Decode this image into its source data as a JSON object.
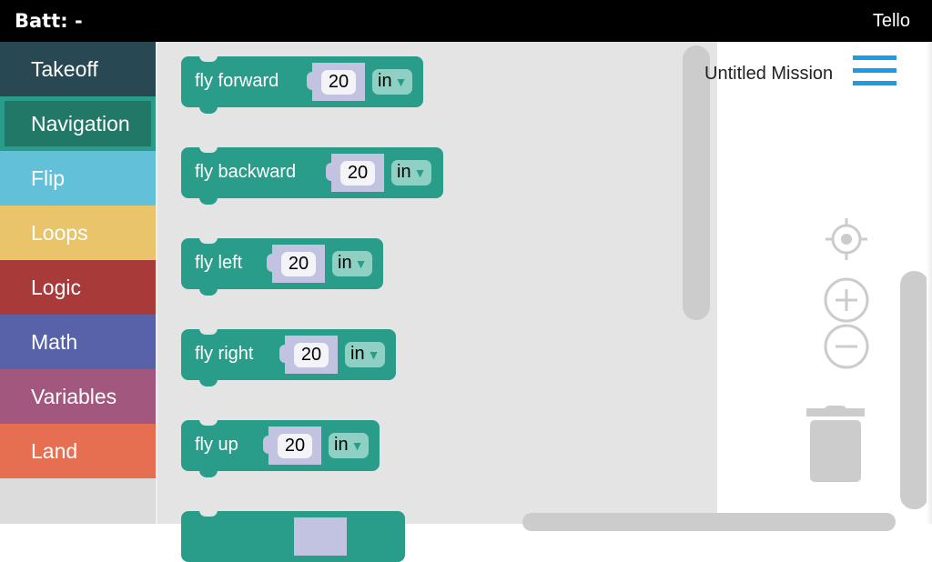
{
  "status_bar": {
    "battery_label": "Batt: -",
    "drone_name": "Tello"
  },
  "sidebar": {
    "categories": [
      {
        "label": "Takeoff",
        "color": "#284954",
        "selected": false
      },
      {
        "label": "Navigation",
        "color": "#2a9d8a",
        "selected": true
      },
      {
        "label": "Flip",
        "color": "#62c0d9",
        "selected": false
      },
      {
        "label": "Loops",
        "color": "#e9c46a",
        "selected": false
      },
      {
        "label": "Logic",
        "color": "#a83a3a",
        "selected": false
      },
      {
        "label": "Math",
        "color": "#5762a8",
        "selected": false
      },
      {
        "label": "Variables",
        "color": "#a2577f",
        "selected": false
      },
      {
        "label": "Land",
        "color": "#e76f51",
        "selected": false
      }
    ]
  },
  "flyout": {
    "blocks": [
      {
        "label": "fly forward",
        "value": "20",
        "unit": "in"
      },
      {
        "label": "fly backward",
        "value": "20",
        "unit": "in"
      },
      {
        "label": "fly left",
        "value": "20",
        "unit": "in"
      },
      {
        "label": "fly right",
        "value": "20",
        "unit": "in"
      },
      {
        "label": "fly up",
        "value": "20",
        "unit": "in"
      },
      {
        "label": "",
        "value": "",
        "unit": ""
      }
    ],
    "dropdown_arrow": "▼"
  },
  "workspace": {
    "mission_title": "Untitled Mission",
    "icons": [
      "recenter-icon",
      "zoom-in-icon",
      "zoom-out-icon",
      "trash-icon",
      "menu-icon"
    ]
  },
  "colors": {
    "block": "#2a9d8a",
    "slot": "#c2c3e0",
    "menu_accent": "#1a9ce6"
  }
}
